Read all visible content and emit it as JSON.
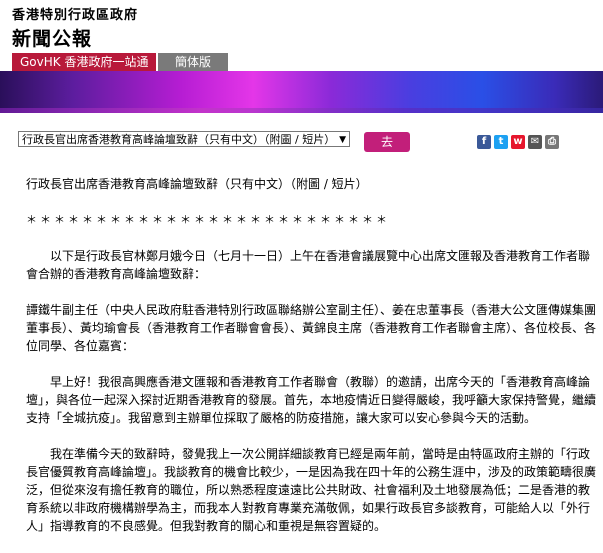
{
  "masthead": {
    "line1": "香港特別行政區政府",
    "line2": "新聞公報"
  },
  "nav": {
    "gov_link": "GovHK 香港政府一站通",
    "lang_link": "簡体版"
  },
  "selector": {
    "value": "行政長官出席香港教育高峰論壇致辭（只有中文）（附圖 / 短片）"
  },
  "go_button": "去",
  "share": [
    {
      "name": "facebook",
      "bg": "#3b5998",
      "glyph": "f"
    },
    {
      "name": "twitter",
      "bg": "#1da1f2",
      "glyph": "t"
    },
    {
      "name": "weibo",
      "bg": "#e6162d",
      "glyph": "w"
    },
    {
      "name": "email",
      "bg": "#555555",
      "glyph": "✉"
    },
    {
      "name": "print",
      "bg": "#777777",
      "glyph": "⎙"
    }
  ],
  "article": {
    "title": "行政長官出席香港教育高峰論壇致辭（只有中文）（附圖 / 短片）",
    "stars": "＊＊＊＊＊＊＊＊＊＊＊＊＊＊＊＊＊＊＊＊＊＊＊＊＊＊",
    "p1": "以下是行政長官林鄭月娥今日（七月十一日）上午在香港會議展覽中心出席文匯報及香港教育工作者聯會合辦的香港教育高峰論壇致辭：",
    "p2": "譚鐵牛副主任（中央人民政府駐香港特別行政區聯絡辦公室副主任）、姜在忠董事長（香港大公文匯傳媒集團董事長）、黃均瑜會長（香港教育工作者聯會會長）、黃錦良主席（香港教育工作者聯會主席）、各位校長、各位同學、各位嘉賓：",
    "p3": "早上好！我很高興應香港文匯報和香港教育工作者聯會（教聯）的邀請，出席今天的「香港教育高峰論壇」，與各位一起深入探討近期香港教育的發展。首先，本地疫情近日變得嚴峻，我呼籲大家保持警覺，繼續支持「全城抗疫」。我留意到主辦單位採取了嚴格的防疫措施，讓大家可以安心參與今天的活動。",
    "p4": "我在準備今天的致辭時，發覺我上一次公開詳細談教育已經是兩年前，當時是由特區政府主辦的「行政長官優質教育高峰論壇」。我談教育的機會比較少，一是因為我在四十年的公務生涯中，涉及的政策範疇很廣泛，但從來沒有擔任教育的職位，所以熟悉程度遠遠比公共財政、社會福利及土地發展為低；二是香港的教育系統以非政府機構辦學為主，而我本人對教育專業充滿敬佩，如果行政長官多談教育，可能給人以「外行人」指導教育的不良感覺。但我對教育的關心和重視是無容置疑的。"
  }
}
